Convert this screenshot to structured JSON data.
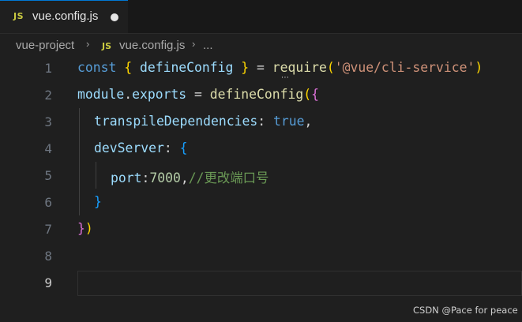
{
  "tab": {
    "badge": "JS",
    "filename": "vue.config.js"
  },
  "breadcrumb": {
    "folder": "vue-project",
    "sep": "›",
    "file_badge": "JS",
    "file": "vue.config.js",
    "more": "..."
  },
  "editor": {
    "line_numbers": [
      "1",
      "2",
      "3",
      "4",
      "5",
      "6",
      "7",
      "8",
      "9"
    ],
    "lines": {
      "l1": {
        "const": "const",
        "lbrace": "{",
        "defineConfig": "defineConfig",
        "rbrace": "}",
        "eq": "=",
        "require": "require",
        "lparen": "(",
        "str": "'@vue/cli-service'",
        "rparen": ")"
      },
      "l2": {
        "module": "module",
        "dot": ".",
        "exports": "exports",
        "eq": "=",
        "defineConfig": "defineConfig",
        "lparen": "(",
        "lbrace": "{"
      },
      "l3": {
        "key": "transpileDependencies",
        "colon": ":",
        "value": "true",
        "comma": ","
      },
      "l4": {
        "key": "devServer",
        "colon": ":",
        "lbrace": "{"
      },
      "l5": {
        "key": "port",
        "colon": ":",
        "value": "7000",
        "comma": ",",
        "comment": "//更改端口号"
      },
      "l6": {
        "rbrace": "}"
      },
      "l7": {
        "rbrace": "}",
        "rparen": ")"
      }
    },
    "hint": "⋯"
  },
  "watermark": "CSDN @Pace for peace"
}
